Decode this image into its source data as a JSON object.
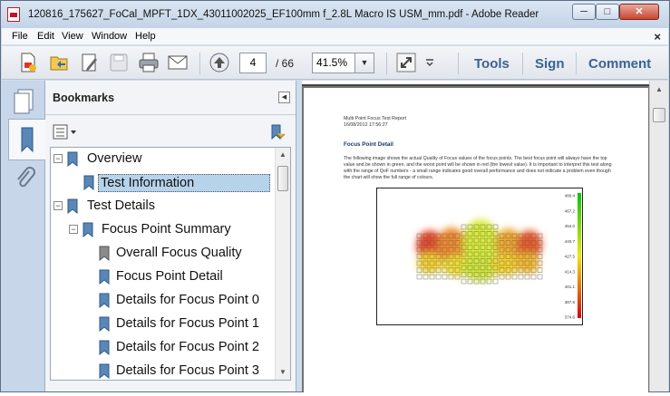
{
  "window": {
    "title": "120816_175627_FoCal_MPFT_1DX_43011002025_EF100mm f_2.8L Macro IS USM_mm.pdf - Adobe Reader",
    "minimize": "─",
    "maximize": "□",
    "close": "✕"
  },
  "menu": {
    "items": [
      "File",
      "Edit",
      "View",
      "Window",
      "Help"
    ],
    "close_doc": "×"
  },
  "toolbar": {
    "page_current": "4",
    "page_total": "/ 66",
    "zoom": "41.5%",
    "zoom_arrow": "▼",
    "tools": "Tools",
    "sign": "Sign",
    "comment": "Comment"
  },
  "bookmarks": {
    "title": "Bookmarks",
    "collapse": "◀",
    "items": [
      {
        "label": "Overview",
        "expander": "−"
      },
      {
        "label": "Test Information"
      },
      {
        "label": "Test Details",
        "expander": "−"
      },
      {
        "label": "Focus Point Summary",
        "expander": "−"
      },
      {
        "label": "Overall Focus Quality"
      },
      {
        "label": "Focus Point Detail"
      },
      {
        "label": "Details for Focus Point 0"
      },
      {
        "label": "Details for Focus Point 1"
      },
      {
        "label": "Details for Focus Point 2"
      },
      {
        "label": "Details for Focus Point 3"
      }
    ]
  },
  "document": {
    "header_line1": "Multi Point Focus Test Report",
    "header_line2": "16/08/2012 17:56:27",
    "section_title": "Focus Point Detail",
    "body_text": "The following image shows the actual Quality of Focus values of the focus points. The best focus point will always have the top value and be shown in green, and the worst point will be shown in red (the lowest value). It is important to interpret this test along with the range of QoF numbers - a small range indicates good overall performance and does not indicate a problem even though the chart will show the full range of colours.",
    "colorbar_ticks": [
      "480.4",
      "467.2",
      "454.0",
      "440.7",
      "427.5",
      "414.3",
      "401.1",
      "387.8",
      "374.6"
    ]
  },
  "colors": {
    "accent": "#3a6390",
    "selection": "#b6d3ec",
    "bookmark_blue": "#5a86b8"
  }
}
